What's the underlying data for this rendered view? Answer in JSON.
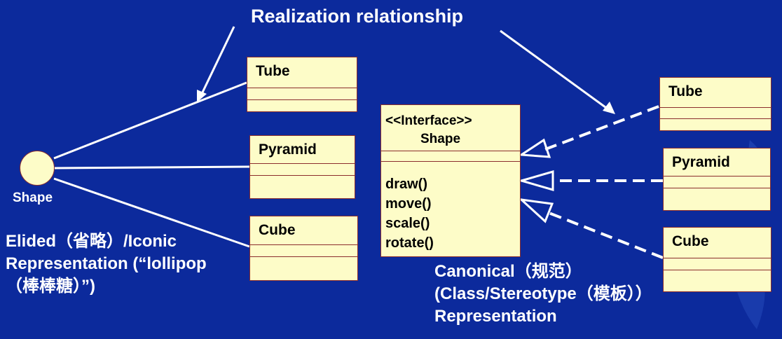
{
  "title": "Realization relationship",
  "lollipop": {
    "label": "Shape"
  },
  "left_classes": [
    "Tube",
    "Pyramid",
    "Cube"
  ],
  "interface": {
    "stereotype": "<<Interface>>",
    "name": "Shape",
    "operations": [
      "draw()",
      "move()",
      "scale()",
      "rotate()"
    ]
  },
  "right_classes": [
    "Tube",
    "Pyramid",
    "Cube"
  ],
  "captions": {
    "elided": [
      "Elided（省略）/Iconic",
      "Representation (“lollipop",
      "（棒棒糖）”)"
    ],
    "canonical": [
      "Canonical（规范）",
      "(Class/Stereotype（模板））",
      "Representation"
    ]
  },
  "colors": {
    "background": "#0c2a9c",
    "box_fill": "#fdfcc8",
    "box_border": "#8b2d2d",
    "line": "#ffffff"
  }
}
